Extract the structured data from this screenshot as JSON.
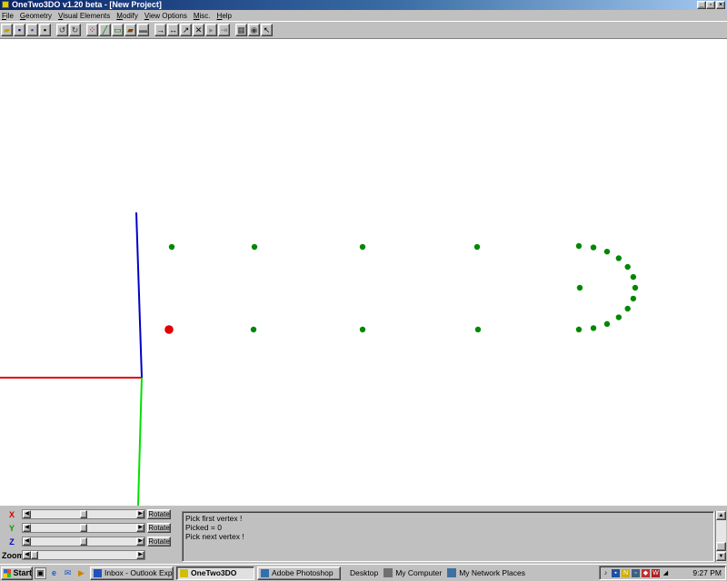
{
  "window": {
    "title": "OneTwo3DO v1.20 beta - [New Project]",
    "buttons": {
      "minimize": "_",
      "restore": "▫",
      "close": "×"
    }
  },
  "menu": [
    "File",
    "Geometry",
    "Visual Elements",
    "Modify",
    "View Options",
    "Misc.",
    "Help"
  ],
  "toolbar": {
    "groups": [
      [
        {
          "name": "open-icon",
          "glyph": "▰",
          "color": "#c8a000"
        },
        {
          "name": "save-icon",
          "glyph": "▪",
          "color": "#000080"
        },
        {
          "name": "save-as-icon",
          "glyph": "▪",
          "color": "#404080"
        },
        {
          "name": "disk-icon",
          "glyph": "▪",
          "color": "#000000"
        }
      ],
      [
        {
          "name": "undo-icon",
          "glyph": "↺",
          "color": "#404040"
        },
        {
          "name": "redo-icon",
          "glyph": "↻",
          "color": "#404040"
        }
      ],
      [
        {
          "name": "vertex-grid-icon",
          "glyph": "⁘",
          "color": "#c00000"
        },
        {
          "name": "line-tool-icon",
          "glyph": "╱",
          "color": "#008000"
        },
        {
          "name": "rect-tool-icon",
          "glyph": "▭",
          "color": "#008000"
        },
        {
          "name": "box-tool-icon",
          "glyph": "▰",
          "color": "#804000"
        },
        {
          "name": "plane-tool-icon",
          "glyph": "▬",
          "color": "#606060"
        }
      ],
      [
        {
          "name": "move-icon",
          "glyph": "→",
          "color": "#000000"
        },
        {
          "name": "move-both-icon",
          "glyph": "↔",
          "color": "#000000"
        },
        {
          "name": "diagonal-move-icon",
          "glyph": "↗",
          "color": "#000000"
        },
        {
          "name": "scale-icon",
          "glyph": "✕",
          "color": "#000000"
        },
        {
          "name": "step-forward-icon",
          "glyph": "▸",
          "color": "#808080"
        },
        {
          "name": "step-end-icon",
          "glyph": "⇥",
          "color": "#808080"
        }
      ],
      [
        {
          "name": "render-icon",
          "glyph": "▦",
          "color": "#404040"
        },
        {
          "name": "view-eye-icon",
          "glyph": "◉",
          "color": "#404040"
        },
        {
          "name": "pointer-icon",
          "glyph": "↖",
          "color": "#000000"
        }
      ]
    ]
  },
  "controls": {
    "rows": [
      {
        "axis": "X",
        "color": "#d00000",
        "button": "Rotate",
        "thumb": 0.5
      },
      {
        "axis": "Y",
        "color": "#00a000",
        "button": "Rotate",
        "thumb": 0.5
      },
      {
        "axis": "Z",
        "color": "#0000d0",
        "button": "Rotate",
        "thumb": 0.5
      },
      {
        "axis": "Zoom",
        "color": "#000000",
        "button": "",
        "thumb": 0.0
      }
    ],
    "log": "Pick first vertex !\nPicked = 0\nPick next vertex !"
  },
  "scene": {
    "axes": {
      "x_color": "#e00000",
      "y_color": "#00e000",
      "z_color": "#0000c8"
    },
    "vertex_color": "#008800",
    "selected_color": "#e00000"
  },
  "taskbar": {
    "start": "Start",
    "tasks": [
      {
        "label": "Inbox - Outlook Express",
        "active": false,
        "icon": "#2050c0"
      },
      {
        "label": "OneTwo3DO",
        "active": true,
        "icon": "#d0c000"
      },
      {
        "label": "Adobe Photoshop",
        "active": false,
        "icon": "#3070b0"
      }
    ],
    "toolbars": [
      {
        "label": "Desktop",
        "icon": ""
      },
      {
        "label": "My Computer",
        "icon": "#707070"
      },
      {
        "label": "My Network Places",
        "icon": "#4070a0"
      }
    ],
    "clock": "9:27 PM"
  }
}
